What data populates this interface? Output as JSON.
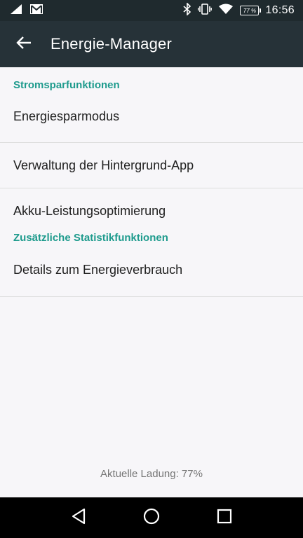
{
  "status_bar": {
    "time": "16:56",
    "battery_percent": "77%",
    "battery_label": "77 %",
    "icons": [
      "signal-icon",
      "gmail-icon",
      "bluetooth-icon",
      "vibrate-icon",
      "wifi-icon",
      "battery-icon"
    ]
  },
  "toolbar": {
    "title": "Energie-Manager",
    "back_icon": "arrow-back-icon"
  },
  "sections": [
    {
      "header": "Stromsparfunktionen",
      "items": [
        {
          "label": "Energiesparmodus"
        },
        {
          "label": "Verwaltung der Hintergrund-App"
        },
        {
          "label": "Akku-Leistungsoptimierung"
        }
      ]
    },
    {
      "header": "Zusätzliche Statistikfunktionen",
      "items": [
        {
          "label": "Details zum Energieverbrauch"
        }
      ]
    }
  ],
  "footer": {
    "charge_text": "Aktuelle Ladung: 77%"
  },
  "nav_bar": {
    "icons": [
      "back-triangle-icon",
      "home-circle-icon",
      "recents-square-icon"
    ]
  },
  "colors": {
    "toolbar_bg": "#263238",
    "statusbar_bg": "#1f2a2e",
    "accent": "#1e9b8d",
    "background": "#f7f6f9"
  }
}
